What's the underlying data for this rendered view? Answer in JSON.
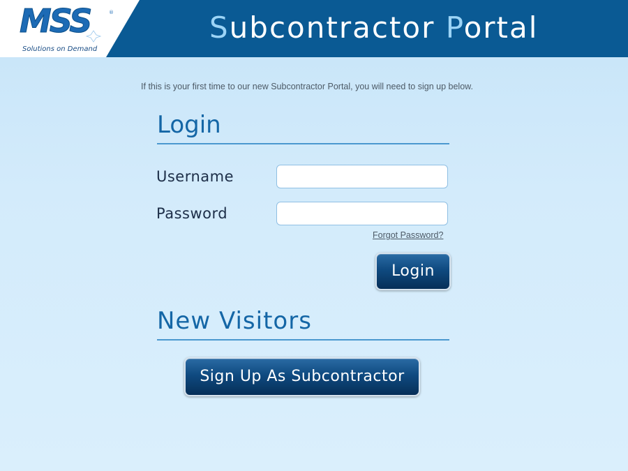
{
  "header": {
    "logo_text": "MSS",
    "logo_registered": "®",
    "logo_tagline": "Solutions on Demand",
    "title_first_initial": "S",
    "title_first_rest": "ubcontractor ",
    "title_second_initial": "P",
    "title_second_rest": "ortal",
    "colors": {
      "bar": "#0a5a94",
      "title": "#ffffff",
      "title_initials": "#9cd4f6",
      "logo": "#1d6bb5"
    }
  },
  "intro_text": "If this is your first time to our new Subcontractor Portal, you will need to sign up below.",
  "login_section": {
    "heading": "Login",
    "username_label": "Username",
    "username_value": "",
    "password_label": "Password",
    "password_value": "",
    "forgot_password_label": "Forgot Password?",
    "login_button_label": "Login"
  },
  "visitors_section": {
    "heading": "New Visitors",
    "signup_button_label": "Sign Up As Subcontractor"
  },
  "colors": {
    "heading": "#1466a6",
    "button": "#0f4a80",
    "background": "#cfe8fa"
  }
}
